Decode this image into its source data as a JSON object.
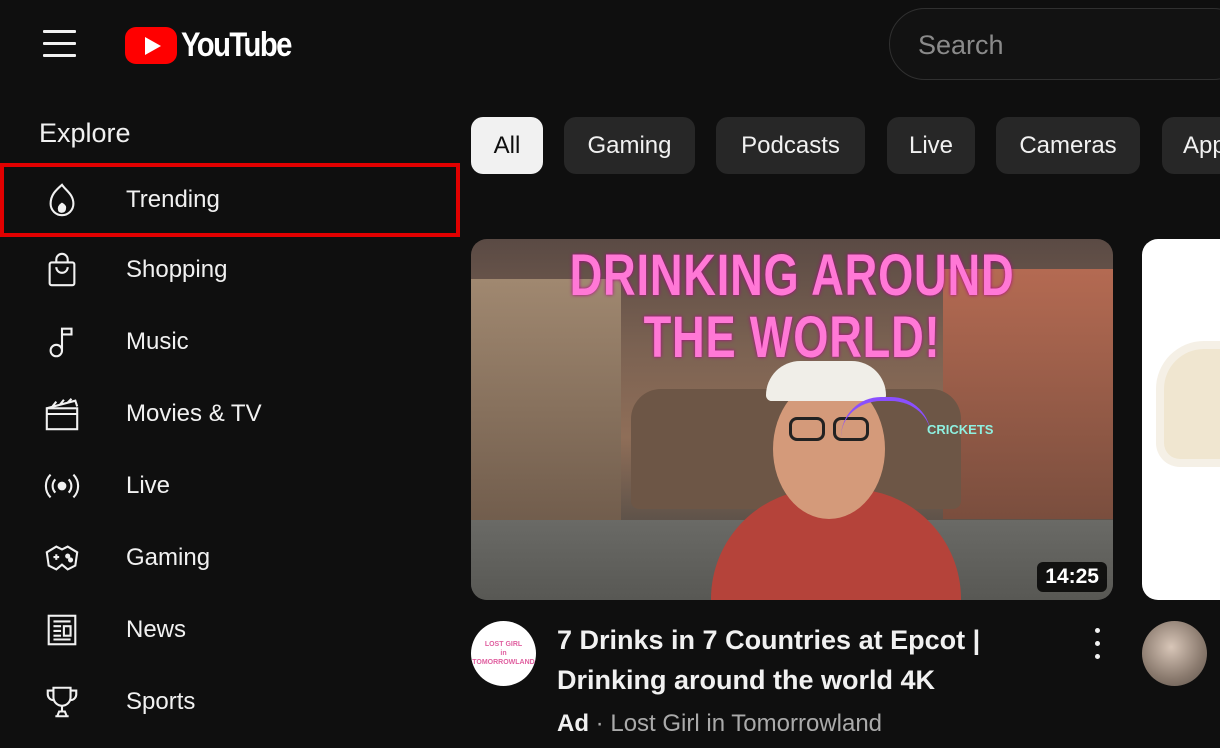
{
  "header": {
    "logo_text": "YouTube",
    "search_placeholder": "Search"
  },
  "sidebar": {
    "section_title": "Explore",
    "items": [
      {
        "label": "Trending",
        "icon": "trending-flame-icon",
        "highlighted": true
      },
      {
        "label": "Shopping",
        "icon": "shopping-bag-icon"
      },
      {
        "label": "Music",
        "icon": "music-note-icon"
      },
      {
        "label": "Movies & TV",
        "icon": "clapperboard-icon"
      },
      {
        "label": "Live",
        "icon": "live-broadcast-icon"
      },
      {
        "label": "Gaming",
        "icon": "game-controller-icon"
      },
      {
        "label": "News",
        "icon": "newspaper-icon"
      },
      {
        "label": "Sports",
        "icon": "trophy-icon"
      }
    ]
  },
  "chips": [
    {
      "label": "All",
      "active": true
    },
    {
      "label": "Gaming"
    },
    {
      "label": "Podcasts"
    },
    {
      "label": "Live"
    },
    {
      "label": "Cameras"
    },
    {
      "label": "Apps"
    }
  ],
  "videos": [
    {
      "thumbnail_text": "DRINKING AROUND THE WORLD!",
      "thumbnail_annotation": "CRICKETS",
      "duration": "14:25",
      "channel_avatar_text": [
        "LOST GIRL",
        "in",
        "TOMORROWLAND"
      ],
      "title": "7 Drinks in 7 Countries at Epcot | Drinking around the world 4K",
      "ad_label": "Ad",
      "separator": "·",
      "channel": "Lost Girl in Tomorrowland"
    }
  ],
  "colors": {
    "background": "#0f0f0f",
    "chip_bg": "#272727",
    "chip_active_bg": "#f1f1f1",
    "highlight_box": "#e10000",
    "logo_red": "#ff0000"
  }
}
